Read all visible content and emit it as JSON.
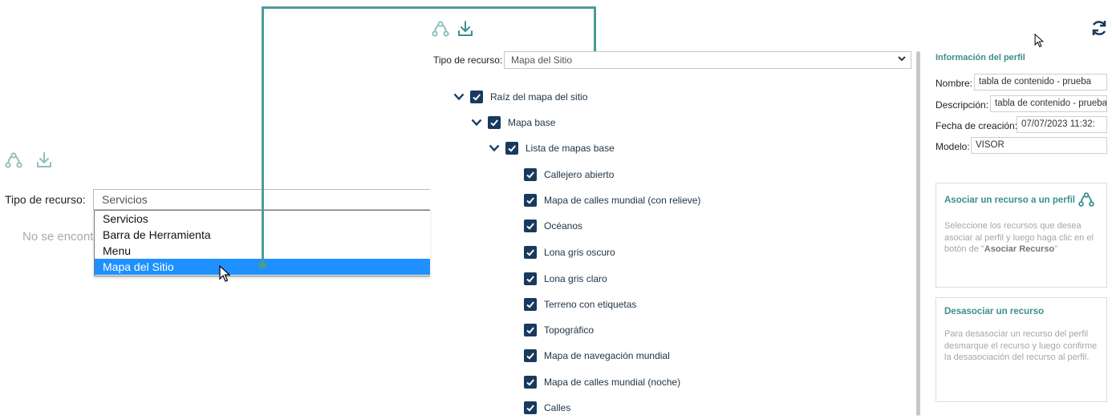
{
  "left_panel": {
    "resource_type_label": "Tipo de recurso:",
    "resource_type_value": "Servicios",
    "empty_message": "No se encontraron",
    "dropdown_options": [
      "Servicios",
      "Barra de Herramienta",
      "Menu",
      "Mapa del Sitio"
    ],
    "selected_option": "Mapa del Sitio"
  },
  "main_panel": {
    "resource_type_label": "Tipo de recurso:",
    "resource_type_value": "Mapa del Sitio",
    "tree": [
      {
        "label": "Raíz del mapa del sitio",
        "level": 0,
        "expanded": true,
        "checked": true
      },
      {
        "label": "Mapa base",
        "level": 1,
        "expanded": true,
        "checked": true
      },
      {
        "label": "Lista de mapas base",
        "level": 2,
        "expanded": true,
        "checked": true
      },
      {
        "label": "Callejero abierto",
        "level": 3,
        "checked": true
      },
      {
        "label": "Mapa de calles mundial (con relieve)",
        "level": 3,
        "checked": true
      },
      {
        "label": "Océanos",
        "level": 3,
        "checked": true
      },
      {
        "label": "Lona gris oscuro",
        "level": 3,
        "checked": true
      },
      {
        "label": "Lona gris claro",
        "level": 3,
        "checked": true
      },
      {
        "label": "Terreno con etiquetas",
        "level": 3,
        "checked": true
      },
      {
        "label": "Topográfico",
        "level": 3,
        "checked": true
      },
      {
        "label": "Mapa de navegación mundial",
        "level": 3,
        "checked": true
      },
      {
        "label": "Mapa de calles mundial (noche)",
        "level": 3,
        "checked": true
      },
      {
        "label": "Calles",
        "level": 3,
        "checked": true
      }
    ]
  },
  "profile_info": {
    "title": "Información del perfil",
    "fields": {
      "name_label": "Nombre:",
      "name_value": "tabla de contenido - prueba",
      "description_label": "Descripción:",
      "description_value": "tabla de contenido - prueba",
      "created_label": "Fecha de creación:",
      "created_value": "07/07/2023 11:32:",
      "model_label": "Modelo:",
      "model_value": "VISOR"
    }
  },
  "associate_card": {
    "title": "Asociar un recurso a un perfil",
    "text_before": "Seleccione los recursos que desea asociar al perfil y luego haga clic en el botón de \"",
    "text_bold": "Asociar Recurso",
    "text_after": "\""
  },
  "disassociate_card": {
    "title": "Desasociar un recurso",
    "text": "Para desasociar un recurso del perfil desmarque el recurso y luego confirme la desasociación del recurso al perfil."
  },
  "icons": {
    "associate": "associate-icon",
    "download": "download-icon",
    "refresh": "refresh-icon"
  },
  "colors": {
    "accent": "#3a8f8d",
    "connector": "#4b9a98",
    "checkbox": "#173a5e",
    "selected_option": "#1e90ff",
    "icon_muted": "#8fbfbd"
  }
}
